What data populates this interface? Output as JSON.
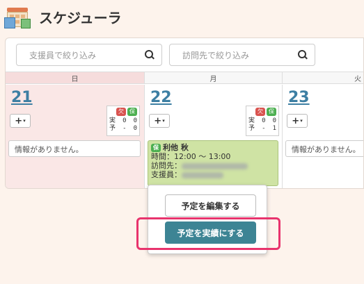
{
  "app": {
    "title": "スケジューラ"
  },
  "search": {
    "staff_placeholder": "支援員で絞り込み",
    "destination_placeholder": "訪問先で絞り込み"
  },
  "days_header": [
    "日",
    "月",
    "火"
  ],
  "days": [
    {
      "number": "21",
      "add_label": "+",
      "badges": [
        "欠",
        "保"
      ],
      "actual_label": "実",
      "actual_values": [
        "0",
        "0"
      ],
      "plan_label": "予",
      "plan_values": [
        "-",
        "0"
      ],
      "no_info": "情報がありません。"
    },
    {
      "number": "22",
      "add_label": "+",
      "badges": [
        "欠",
        "保"
      ],
      "actual_label": "実",
      "actual_values": [
        "0",
        "0"
      ],
      "plan_label": "予",
      "plan_values": [
        "-",
        "1"
      ]
    },
    {
      "number": "23",
      "add_label": "+",
      "no_info": "情報がありません。"
    }
  ],
  "event": {
    "badge": "保",
    "name": "利他 秋",
    "time_label": "時間：",
    "time_value": "12:00 ～ 13:00",
    "destination_label": "訪問先：",
    "staff_label": "支援員："
  },
  "popup": {
    "edit_label": "予定を編集する",
    "complete_label": "予定を実績にする"
  },
  "colors": {
    "accent": "#3d8494",
    "highlight": "#e8336d",
    "event_bg": "#cfe3a4",
    "day_link": "#3d7fa3"
  }
}
